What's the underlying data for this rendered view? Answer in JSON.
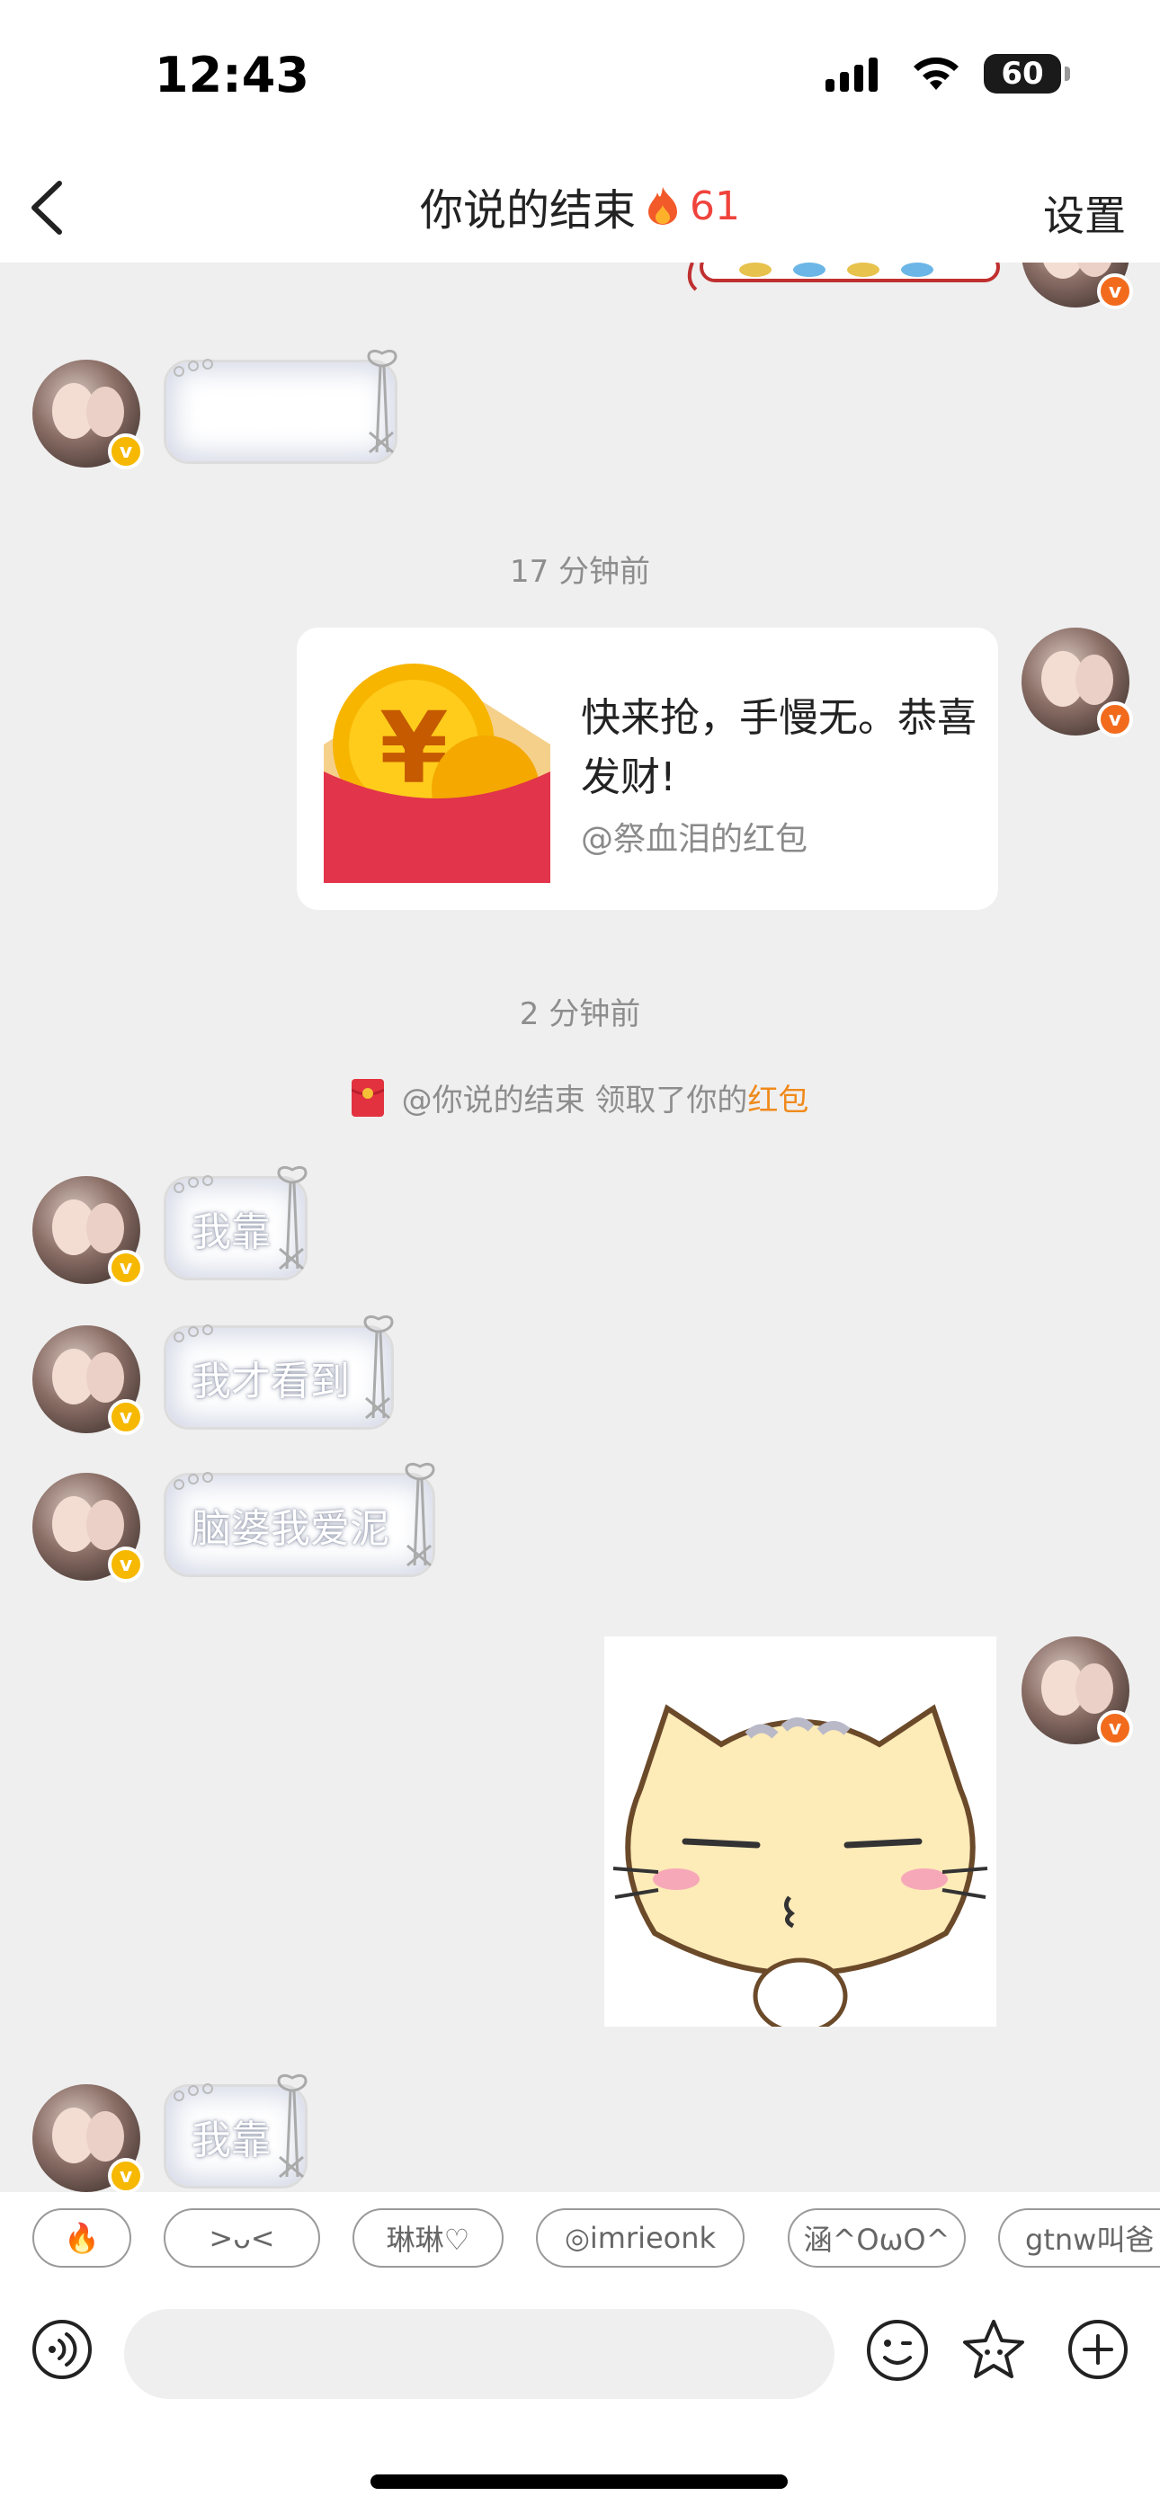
{
  "status_bar": {
    "time": "12:43",
    "battery": "60"
  },
  "nav": {
    "title": "你说的结束",
    "streak": "61",
    "settings": "设置"
  },
  "messages": {
    "m1_emoji": "😭😭😭",
    "timestamp1": "17 分钟前",
    "red_packet": {
      "text": "快来抢，手慢无。恭喜发财!",
      "from": "@祭血泪的红包"
    },
    "timestamp2": "2 分钟前",
    "notice": {
      "text": "@你说的结束 领取了你的",
      "link": "红包"
    },
    "m2": "我靠",
    "m3": "我才看到",
    "m4": "脑婆我爱泥",
    "m5": "我靠"
  },
  "quick_replies": [
    "🔥",
    ">ᴗ<",
    "琳琳♡",
    "◎imrieonk",
    "涵^OωO^",
    "gtnw叫爸"
  ],
  "input": {
    "placeholder": ""
  },
  "colors": {
    "accent_red": "#f0433c",
    "link_orange": "#f08a1c",
    "badge_gold": "#f6b800",
    "badge_orange": "#f26b1d"
  }
}
